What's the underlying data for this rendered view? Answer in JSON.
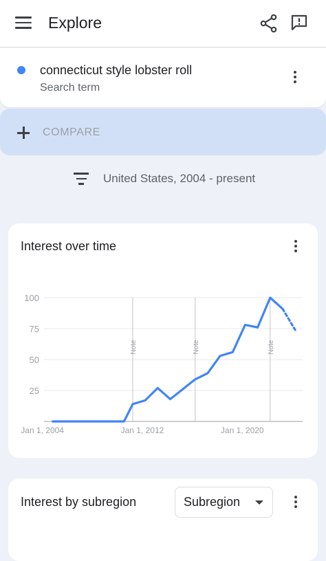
{
  "app": {
    "title": "Explore"
  },
  "icons": {
    "menu": "menu-icon",
    "share": "share-icon",
    "feedback": "feedback-icon",
    "more": "more-vert-icon",
    "add": "add-icon",
    "filter": "filter-icon",
    "dropdown": "arrow-drop-down-icon"
  },
  "colors": {
    "series": "#4285f4",
    "compare_bg": "#d2e0f7",
    "page_bg": "#eef1f7"
  },
  "search_term": {
    "name": "connecticut style lobster roll",
    "type": "Search term"
  },
  "compare": {
    "label": "COMPARE"
  },
  "filter": {
    "label": "United States, 2004 - present"
  },
  "interest_over_time": {
    "title": "Interest over time"
  },
  "chart_data": {
    "type": "line",
    "title": "",
    "x_tick_labels": [
      "Jan 1, 2004",
      "Jan 1, 2012",
      "Jan 1, 2020"
    ],
    "y_tick_labels": [
      "100",
      "75",
      "50",
      "25"
    ],
    "ylim": [
      0,
      100
    ],
    "note_label": "Note",
    "notes_at": [
      2011.0,
      2016.0,
      2022.0
    ],
    "series": [
      {
        "values_x": [
          2004.6,
          2005,
          2006,
          2007,
          2008,
          2009,
          2010,
          2010.3,
          2011,
          2012,
          2013,
          2014,
          2015,
          2016,
          2017,
          2018,
          2019,
          2020,
          2021,
          2022,
          2023
        ],
        "values_y": [
          0,
          0,
          0,
          0,
          0,
          0,
          0,
          0,
          14,
          17,
          27,
          18,
          26,
          34,
          39,
          53,
          56,
          78,
          76,
          100,
          91
        ],
        "partial": {
          "x": [
            2023,
            2024
          ],
          "y": [
            91,
            74
          ]
        }
      }
    ],
    "grid": true
  },
  "interest_by_subregion": {
    "title": "Interest by subregion",
    "dropdown_value": "Subregion"
  }
}
